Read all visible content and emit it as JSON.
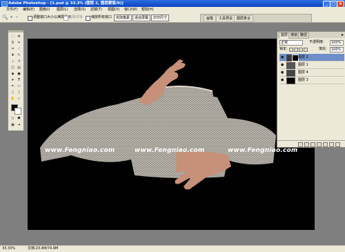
{
  "window": {
    "title": "Adobe Photoshop - [1.psd @ 33.3% (图层 2, 图层蒙版/8)]",
    "controls": [
      "_",
      "□",
      "×"
    ]
  },
  "menubar": {
    "items": [
      "文件(F)",
      "编辑(E)",
      "图像(I)",
      "图层(L)",
      "选择(S)",
      "滤镜(T)",
      "视图(V)",
      "窗口(W)",
      "帮助(H)"
    ]
  },
  "options_bar": {
    "resize_windows_label": "调整窗口大小以满屏显示",
    "ignore_palettes_label": "忽略调板",
    "zoom_all_label": "缩放所有窗口",
    "actual_pixels": "实际像素",
    "fit_on_screen": "适合屏幕",
    "print_size": "打印尺寸"
  },
  "palette_well": {
    "tabs": [
      "画笔",
      "工具预设",
      "图层复合"
    ]
  },
  "layers_palette": {
    "tabs": [
      "图层",
      "通道",
      "路径"
    ],
    "blend_mode": "正常",
    "opacity_label": "不透明度:",
    "opacity_value": "100%",
    "lock_label": "锁定:",
    "fill_label": "填充:",
    "fill_value": "100%",
    "layers": [
      {
        "name": "图层 2",
        "selected": true
      },
      {
        "name": "图层 1",
        "selected": false
      },
      {
        "name": "图层 4",
        "selected": false
      },
      {
        "name": "图层 3",
        "selected": false
      }
    ]
  },
  "watermark": {
    "text": "www.Fengniao.com"
  },
  "status_bar": {
    "zoom": "33.33%",
    "doc_info": "文档:23.4M/74.9M"
  },
  "colors": {
    "title_bar": "#0a44c2",
    "workspace": "#7f7f7f",
    "canvas": "#000000",
    "selected_layer": "#6d8ec9"
  }
}
